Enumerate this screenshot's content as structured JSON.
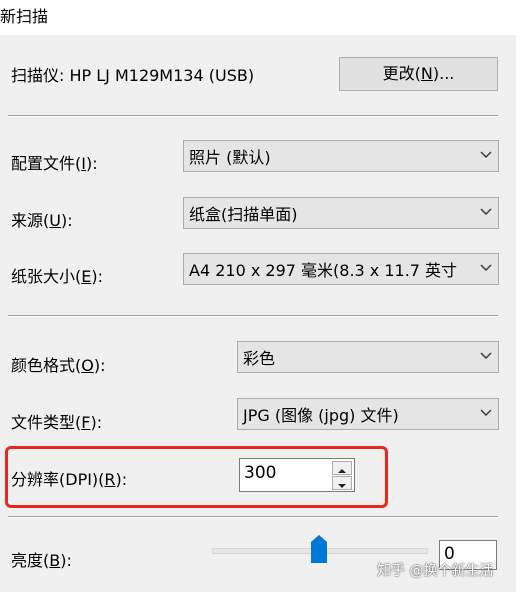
{
  "window": {
    "title": "新扫描"
  },
  "scanner": {
    "label": "扫描仪: HP LJ M129M134 (USB)",
    "change_button": "更改(N)..."
  },
  "profile": {
    "label": "配置文件(I):",
    "value": "照片 (默认)"
  },
  "source": {
    "label": "来源(U):",
    "value": "纸盒(扫描单面)"
  },
  "paper_size": {
    "label": "纸张大小(E):",
    "value": "A4 210 x 297 毫米(8.3 x 11.7 英寸"
  },
  "color_format": {
    "label": "颜色格式(O):",
    "value": "彩色"
  },
  "file_type": {
    "label": "文件类型(F):",
    "value": "JPG (图像 (jpg) 文件)"
  },
  "resolution": {
    "label": "分辨率(DPI)(R):",
    "value": "300"
  },
  "brightness": {
    "label": "亮度(B):",
    "value": "0",
    "level_percent": 50
  },
  "watermark": {
    "text": "知乎 @换个新生活"
  },
  "colors": {
    "highlight": "#e52a20",
    "thumb": "#0078d7"
  }
}
